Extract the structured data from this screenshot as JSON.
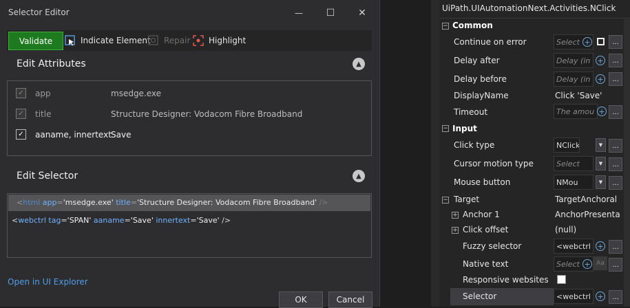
{
  "dialog": {
    "title": "Selector Editor",
    "window_buttons": {
      "minimize": "—",
      "maximize": "☐",
      "close": "✕"
    },
    "toolbar": {
      "validate_label": "Validate",
      "indicate_label": "Indicate Element",
      "repair_label": "Repair",
      "highlight_label": "Highlight"
    },
    "edit_attributes": {
      "title": "Edit Attributes",
      "rows": [
        {
          "name": "app",
          "value": "msedge.exe",
          "checked": true,
          "enabled": false
        },
        {
          "name": "title",
          "value": "Structure Designer: Vodacom Fibre Broadband",
          "checked": false,
          "enabled": false
        },
        {
          "name": "aaname, innertext",
          "value": "Save",
          "checked": true,
          "enabled": true
        }
      ]
    },
    "edit_selector": {
      "title": "Edit Selector",
      "line1": {
        "tag": "html",
        "attr1": "app",
        "val1": "'msedge.exe'",
        "attr2": "title",
        "val2": "'Structure Designer: Vodacom Fibre Broadband'",
        "end": "/>"
      },
      "line2": {
        "open": "<",
        "tag": "webctrl",
        "attr1": "tag",
        "val1": "'SPAN'",
        "attr2": "aaname",
        "val2": "'Save'",
        "attr3": "innertext",
        "val3": "'Save'",
        "end": "/>"
      }
    },
    "open_in_explorer": "Open in UI Explorer",
    "ok_label": "OK",
    "cancel_label": "Cancel"
  },
  "properties": {
    "title": "UiPath.UIAutomationNext.Activities.NClick",
    "common": {
      "label": "Common",
      "continue_on_error": {
        "label": "Continue on error",
        "placeholder": "Select"
      },
      "delay_after": {
        "label": "Delay after",
        "placeholder": "Delay (in :"
      },
      "delay_before": {
        "label": "Delay before",
        "placeholder": "Delay (in :"
      },
      "display_name": {
        "label": "DisplayName",
        "value": "Click 'Save'"
      },
      "timeout": {
        "label": "Timeout",
        "placeholder": "The amou"
      }
    },
    "input": {
      "label": "Input",
      "click_type": {
        "label": "Click type",
        "value": "NClick"
      },
      "cursor_motion_type": {
        "label": "Cursor motion type",
        "placeholder": "Select"
      },
      "mouse_button": {
        "label": "Mouse button",
        "value": "NMou"
      }
    },
    "target": {
      "label": "Target",
      "value": "TargetAnchoral",
      "anchor1": {
        "label": "Anchor 1",
        "value": "AnchorPresenta"
      },
      "click_offset": {
        "label": "Click offset",
        "value": "(null)"
      },
      "fuzzy_selector": {
        "label": "Fuzzy selector",
        "value": "<webctrl"
      },
      "native_text": {
        "label": "Native text",
        "placeholder": "Select"
      },
      "responsive_websites": {
        "label": "Responsive websites"
      },
      "selector": {
        "label": "Selector",
        "value": "<webctrl t"
      }
    }
  }
}
